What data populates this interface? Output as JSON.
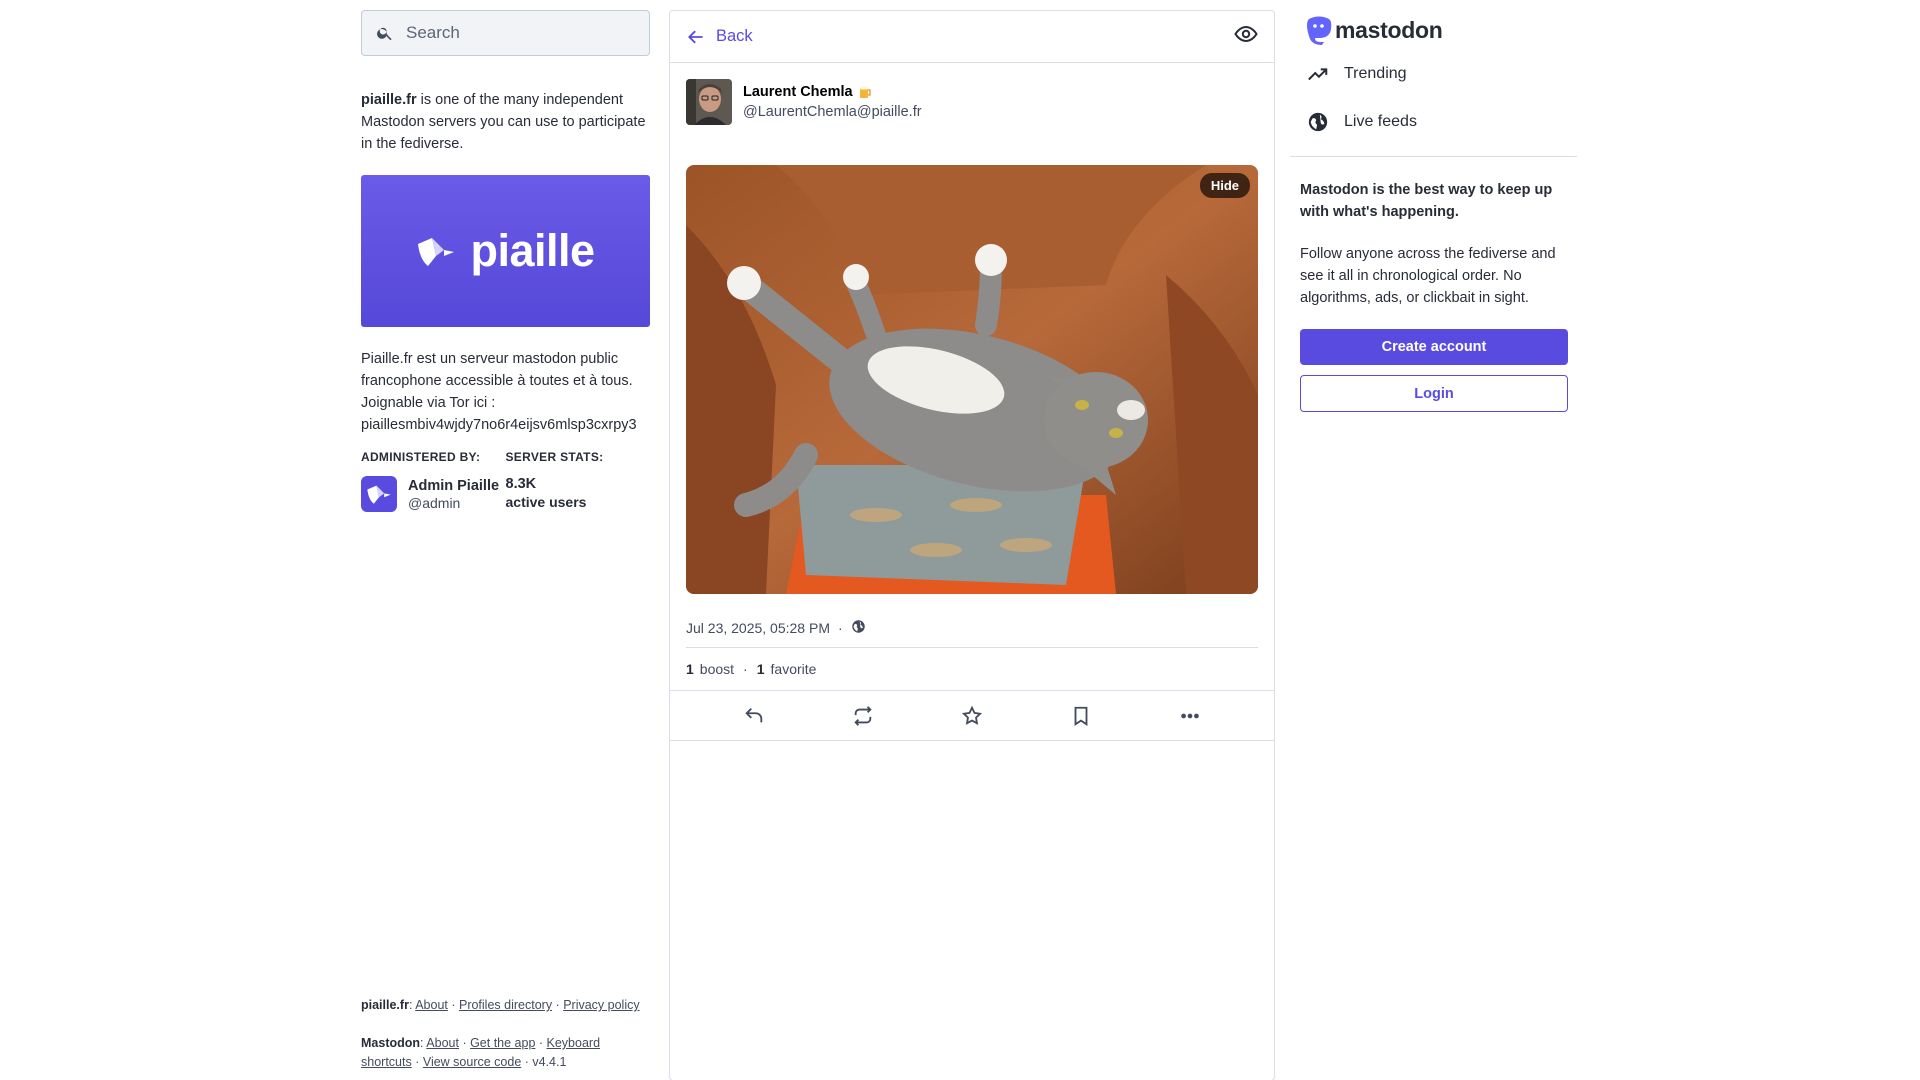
{
  "search": {
    "placeholder": "Search",
    "icon": "search-icon"
  },
  "server": {
    "domain": "piaille.fr",
    "intro_rest": " is one of the many independent Mastodon servers you can use to participate in the fediverse.",
    "banner_word": "piaille",
    "description_lines": [
      "Piaille.fr est un serveur mastodon public",
      "francophone accessible à toutes et à tous.",
      "Joignable via Tor ici :",
      "piaillesmbiv4wjdy7no6r4eijsv6mlsp3cxrpy3"
    ],
    "administered_by_label": "ADMINISTERED BY:",
    "admin_name": "Admin Piaille",
    "admin_handle": "@admin",
    "server_stats_label": "SERVER STATS:",
    "active_users_value": "8.3K",
    "active_users_label": "active users"
  },
  "footer": {
    "site_label": "piaille.fr",
    "site_links": [
      "About",
      "Profiles directory",
      "Privacy policy"
    ],
    "mastodon_label": "Mastodon",
    "mastodon_links": [
      "About",
      "Get the app",
      "Keyboard shortcuts",
      "View source code"
    ],
    "version": "v4.4.1"
  },
  "column": {
    "back_label": "Back",
    "icon_back": "arrow-left-icon",
    "icon_visibility": "eye-icon"
  },
  "status": {
    "author_name": "Laurent Chemla",
    "author_emoji": "beer-mug-icon",
    "author_acct": "@LaurentChemla@piaille.fr",
    "media_hide_label": "Hide",
    "media_alt": "grey-white cat on leather armchair",
    "timestamp": "Jul 23, 2025, 05:28 PM",
    "visibility_icon": "globe-icon",
    "boosts_count": "1",
    "boosts_label": "boost",
    "favorites_count": "1",
    "favorites_label": "favorite"
  },
  "actions": [
    "reply-icon",
    "boost-icon",
    "star-icon",
    "bookmark-icon",
    "more-icon"
  ],
  "nav": {
    "logo_word": "mastodon",
    "items": [
      {
        "label": "Trending",
        "icon": "trending-icon"
      },
      {
        "label": "Live feeds",
        "icon": "globe-icon"
      }
    ]
  },
  "pitch": {
    "title": "Mastodon is the best way to keep up with what's happening.",
    "body": "Follow anyone across the fediverse and see it all in chronological order. No algorithms, ads, or clickbait in sight.",
    "create_label": "Create account",
    "login_label": "Login"
  },
  "colors": {
    "accent": "#5a4be0",
    "text": "#282c37",
    "muted": "#444b5d",
    "border": "#dadeea"
  }
}
